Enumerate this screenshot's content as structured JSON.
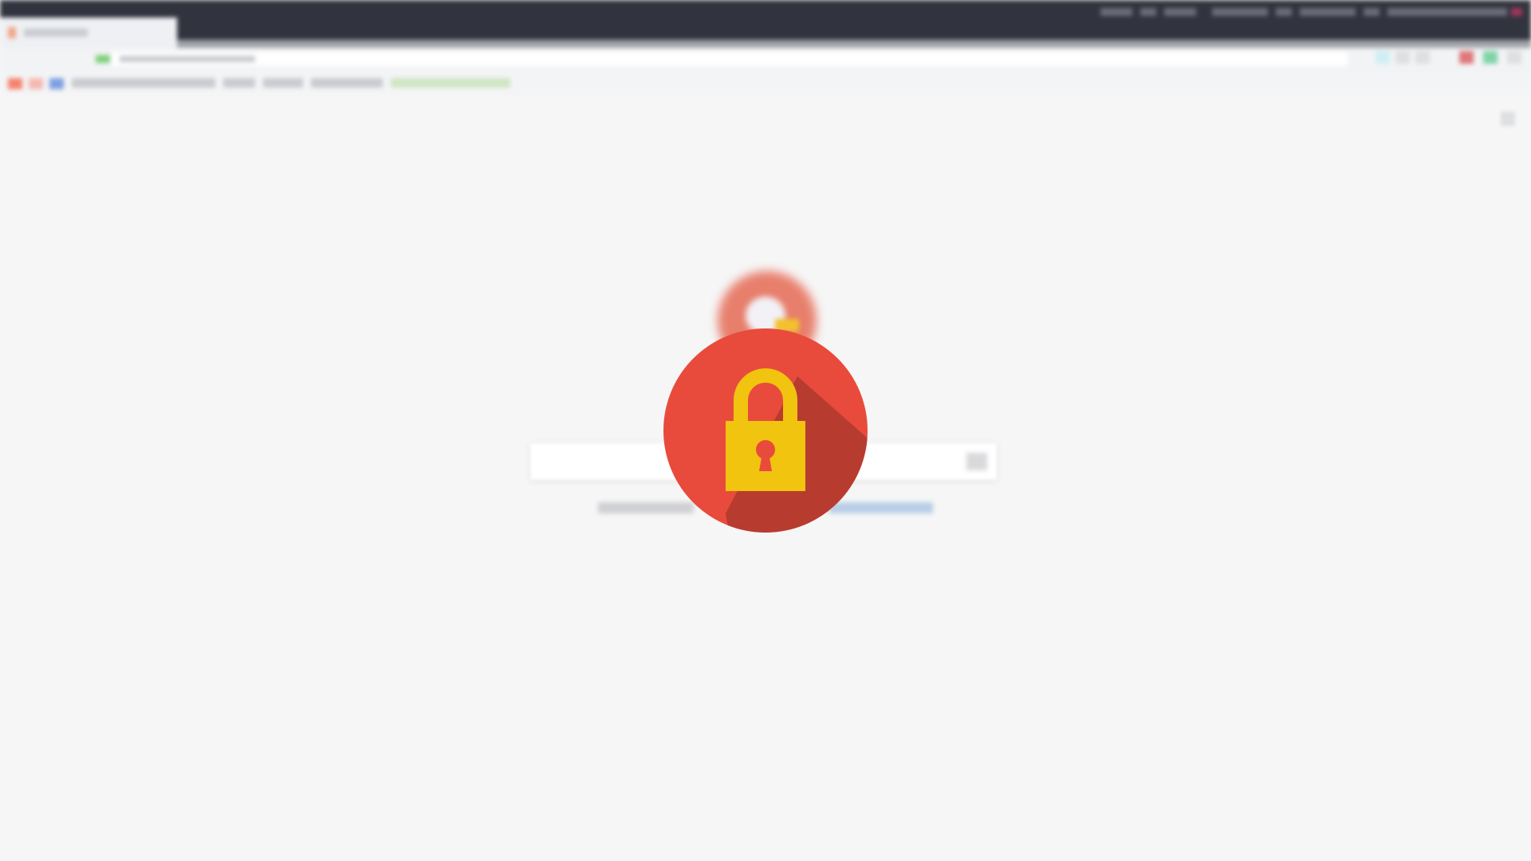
{
  "colors": {
    "page_background": "#f6f6f6",
    "os_bar": "#31343e",
    "lock_circle": "#e84b3c",
    "lock_shadow": "#b83b30",
    "lock_body": "#f1c40f",
    "search_logo_red": "#e4573f",
    "search_logo_yellow": "#f2c12e"
  },
  "icons": {
    "lock": "padlock-icon",
    "search_logo": "search-engine-logo",
    "extensions": [
      "extension-icon",
      "extension-icon",
      "extension-icon",
      "extension-icon",
      "extension-icon",
      "extension-icon"
    ]
  },
  "state": {
    "background_obscured": true,
    "overlay": "locked"
  }
}
